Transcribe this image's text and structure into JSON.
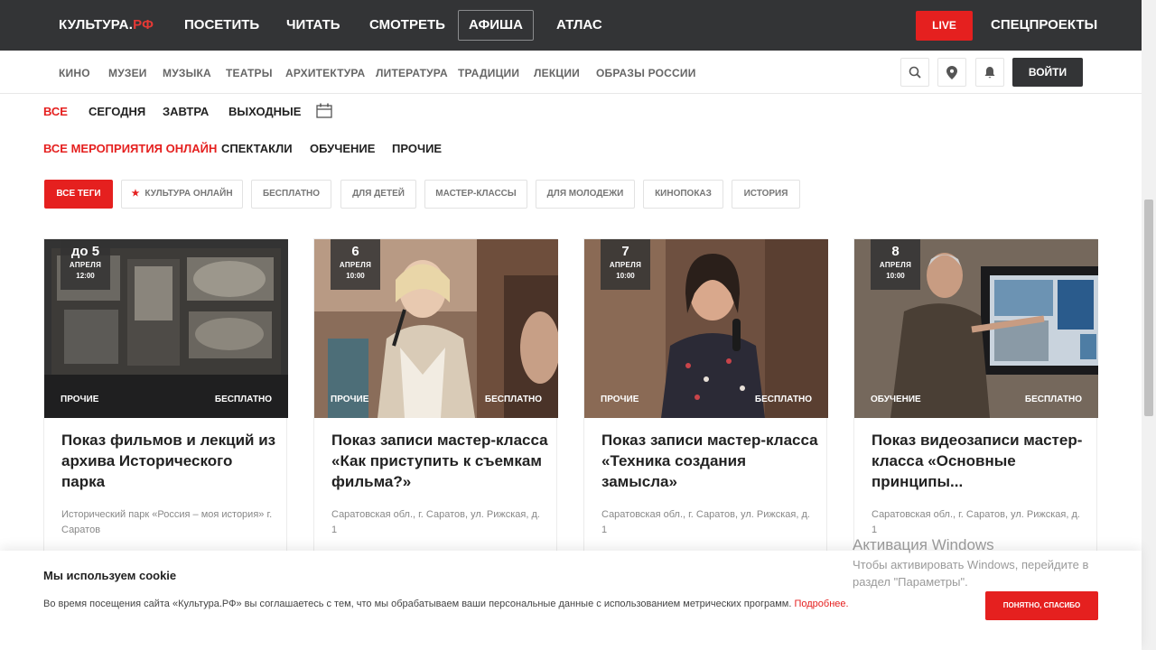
{
  "header": {
    "logo_main": "КУЛЬТУРА.",
    "logo_accent": "РФ",
    "nav": [
      "ПОСЕТИТЬ",
      "ЧИТАТЬ",
      "СМОТРЕТЬ"
    ],
    "active": "АФИША",
    "atlas": "АТЛАС",
    "live": "LIVE",
    "special": "СПЕЦПРОЕКТЫ"
  },
  "subnav": {
    "items": [
      "КИНО",
      "МУЗЕИ",
      "МУЗЫКА",
      "ТЕАТРЫ",
      "АРХИТЕКТУРА",
      "ЛИТЕРАТУРА",
      "ТРАДИЦИИ",
      "ЛЕКЦИИ",
      "ОБРАЗЫ РОССИИ"
    ],
    "login": "ВОЙТИ"
  },
  "date_filters": [
    "ВСЕ",
    "СЕГОДНЯ",
    "ЗАВТРА",
    "ВЫХОДНЫЕ"
  ],
  "type_filters": [
    "ВСЕ МЕРОПРИЯТИЯ ОНЛАЙН",
    "СПЕКТАКЛИ",
    "ОБУЧЕНИЕ",
    "ПРОЧИЕ"
  ],
  "tags": [
    "ВСЕ ТЕГИ",
    "КУЛЬТУРА ОНЛАЙН",
    "БЕСПЛАТНО",
    "ДЛЯ ДЕТЕЙ",
    "МАСТЕР-КЛАССЫ",
    "ДЛЯ МОЛОДЕЖИ",
    "КИНОПОКАЗ",
    "ИСТОРИЯ"
  ],
  "cards": [
    {
      "date": "до 5",
      "month": "АПРЕЛЯ",
      "time": "12:00",
      "category": "ПРОЧИЕ",
      "price": "БЕСПЛАТНО",
      "title": "Показ фильмов и лекций из архива Исторического парка",
      "place": "Исторический парк «Россия – моя история» г. Саратов"
    },
    {
      "date": "6",
      "month": "АПРЕЛЯ",
      "time": "10:00",
      "category": "ПРОЧИЕ",
      "price": "БЕСПЛАТНО",
      "title": "Показ записи мастер-класса «Как приступить к съемкам фильма?»",
      "place": "Саратовская обл., г. Саратов, ул. Рижская, д. 1"
    },
    {
      "date": "7",
      "month": "АПРЕЛЯ",
      "time": "10:00",
      "category": "ПРОЧИЕ",
      "price": "БЕСПЛАТНО",
      "title": "Показ записи мастер-класса «Техника создания замысла»",
      "place": "Саратовская обл., г. Саратов, ул. Рижская, д. 1"
    },
    {
      "date": "8",
      "month": "АПРЕЛЯ",
      "time": "10:00",
      "category": "ОБУЧЕНИЕ",
      "price": "БЕСПЛАТНО",
      "title": "Показ видеозаписи мастер-класса «Основные принципы...",
      "place": "Саратовская обл., г. Саратов, ул. Рижская, д. 1"
    }
  ],
  "cookie": {
    "title": "Мы используем cookie",
    "text": "Во время посещения сайта «Культура.РФ» вы соглашаетесь с тем, что мы обрабатываем ваши персональные данные с использованием метрических программ.",
    "link": "Подробнее.",
    "button": "ПОНЯТНО, СПАСИБО"
  },
  "windows": {
    "title": "Активация Windows",
    "text": "Чтобы активировать Windows, перейдите в раздел \"Параметры\"."
  },
  "colors": {
    "accent": "#e5201f",
    "header_bg": "#333436"
  }
}
